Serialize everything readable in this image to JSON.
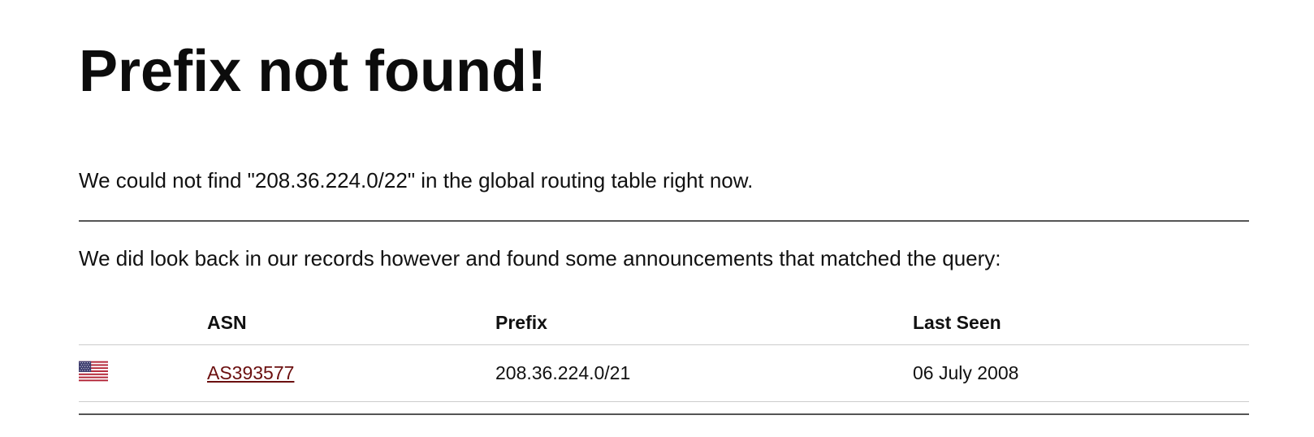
{
  "heading": "Prefix not found!",
  "not_found_message": "We could not find \"208.36.224.0/22\" in the global routing table right now.",
  "history_message": "We did look back in our records however and found some announcements that matched the query:",
  "table": {
    "headers": {
      "flag": "",
      "asn": "ASN",
      "prefix": "Prefix",
      "last_seen": "Last Seen"
    },
    "rows": [
      {
        "flag_icon": "us-flag-icon",
        "asn": "AS393577",
        "prefix": "208.36.224.0/21",
        "last_seen": "06 July 2008"
      }
    ]
  },
  "colors": {
    "link": "#6b0f0f",
    "rule": "#555555",
    "text": "#111111"
  }
}
